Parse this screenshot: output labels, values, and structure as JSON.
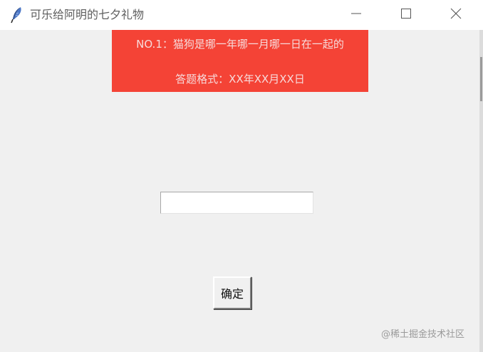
{
  "window": {
    "title": "可乐给阿明的七夕礼物",
    "icon": "feather-icon",
    "controls": [
      "minimize-icon",
      "maximize-icon",
      "close-icon"
    ]
  },
  "question": {
    "line1": "NO.1：猫狗是哪一年哪一月哪一日在一起的",
    "line2": "答题格式：XX年XX月XX日",
    "background_color": "#f44336"
  },
  "answer_input": {
    "value": "",
    "placeholder": ""
  },
  "confirm_button": {
    "label": "确定"
  },
  "watermark": {
    "text": "@稀土掘金技术社区"
  }
}
